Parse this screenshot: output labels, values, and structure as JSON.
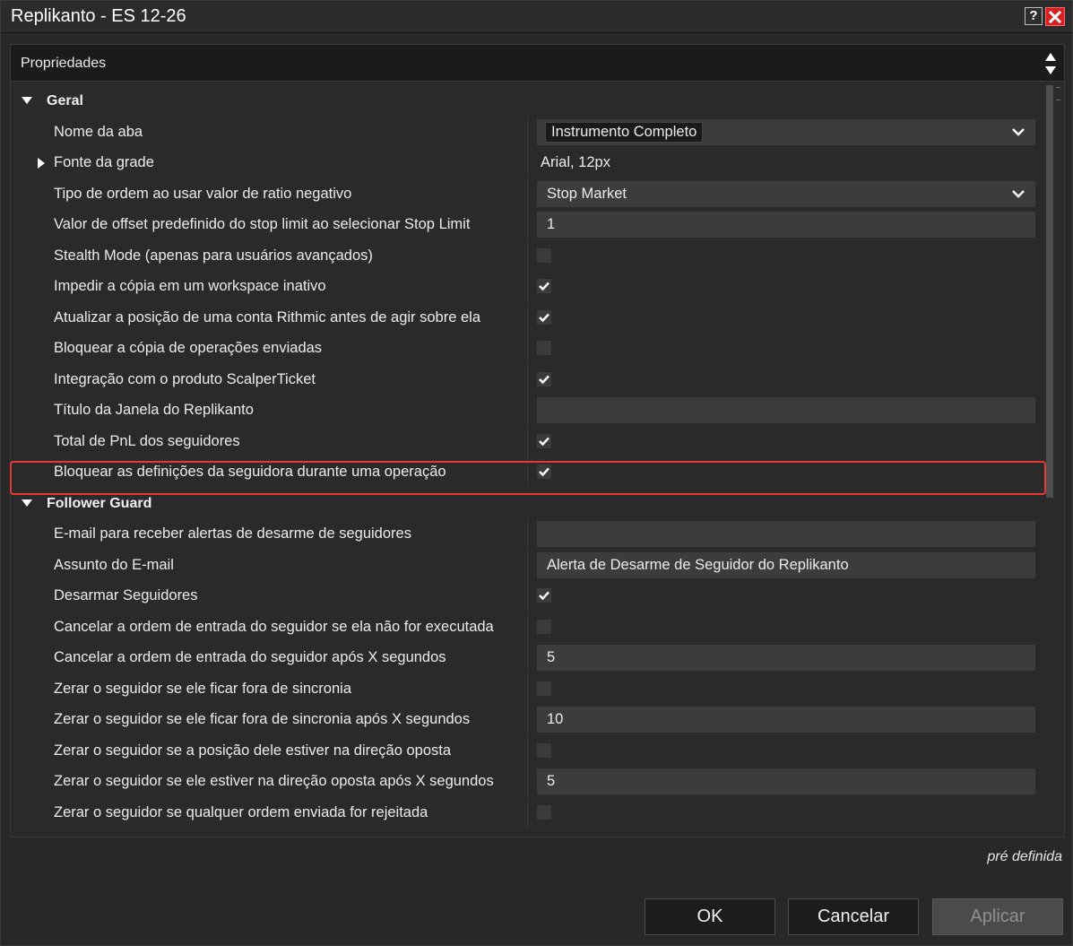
{
  "window": {
    "title": "Replikanto - ES 12-26",
    "help_label": "?"
  },
  "properties": {
    "header": "Propriedades"
  },
  "categories": {
    "geral": "Geral",
    "follower_guard": "Follower Guard"
  },
  "geral": [
    {
      "label": "Nome da aba",
      "type": "dropdown-highlight",
      "value": "Instrumento Completo"
    },
    {
      "label": "Fonte da grade",
      "type": "text",
      "value": "Arial, 12px"
    },
    {
      "label": "Tipo de ordem ao usar valor de ratio negativo",
      "type": "dropdown",
      "value": "Stop Market"
    },
    {
      "label": "Valor de offset predefinido do stop limit ao selecionar Stop Limit",
      "type": "input",
      "value": "1"
    },
    {
      "label": "Stealth Mode (apenas para usuários avançados)",
      "type": "checkbox",
      "checked": false
    },
    {
      "label": "Impedir a cópia em um workspace inativo",
      "type": "checkbox",
      "checked": true
    },
    {
      "label": "Atualizar a posição de uma conta Rithmic antes de agir sobre ela",
      "type": "checkbox",
      "checked": true
    },
    {
      "label": "Bloquear a cópia de operações enviadas",
      "type": "checkbox",
      "checked": false
    },
    {
      "label": "Integração com o produto ScalperTicket",
      "type": "checkbox",
      "checked": true
    },
    {
      "label": "Título da Janela do Replikanto",
      "type": "input",
      "value": ""
    },
    {
      "label": "Total de PnL dos seguidores",
      "type": "checkbox",
      "checked": true
    },
    {
      "label": "Bloquear as definições da seguidora durante uma operação",
      "type": "checkbox",
      "checked": true
    }
  ],
  "follower_guard": [
    {
      "label": "E-mail para receber alertas de desarme de seguidores",
      "type": "input",
      "value": ""
    },
    {
      "label": "Assunto do E-mail",
      "type": "input",
      "value": "Alerta de Desarme de Seguidor do Replikanto"
    },
    {
      "label": "Desarmar Seguidores",
      "type": "checkbox",
      "checked": true
    },
    {
      "label": "Cancelar a ordem de entrada do seguidor se ela não for executada",
      "type": "checkbox",
      "checked": false
    },
    {
      "label": "Cancelar a ordem de entrada do seguidor após X segundos",
      "type": "input",
      "value": "5"
    },
    {
      "label": "Zerar o seguidor se ele ficar fora de sincronia",
      "type": "checkbox",
      "checked": false
    },
    {
      "label": "Zerar o seguidor se ele ficar fora de sincronia após X segundos",
      "type": "input",
      "value": "10"
    },
    {
      "label": "Zerar o seguidor se a posição dele estiver na direção oposta",
      "type": "checkbox",
      "checked": false
    },
    {
      "label": "Zerar o seguidor se ele estiver na direção oposta após X segundos",
      "type": "input",
      "value": "5"
    },
    {
      "label": "Zerar o seguidor se qualquer ordem enviada for rejeitada",
      "type": "checkbox",
      "checked": false
    }
  ],
  "footnote": "pré definida",
  "buttons": {
    "ok": "OK",
    "cancel": "Cancelar",
    "apply": "Aplicar"
  },
  "colors": {
    "background": "#282828",
    "field": "#3c3c3c",
    "highlight_border": "#e53935",
    "close_button": "#d42020"
  }
}
